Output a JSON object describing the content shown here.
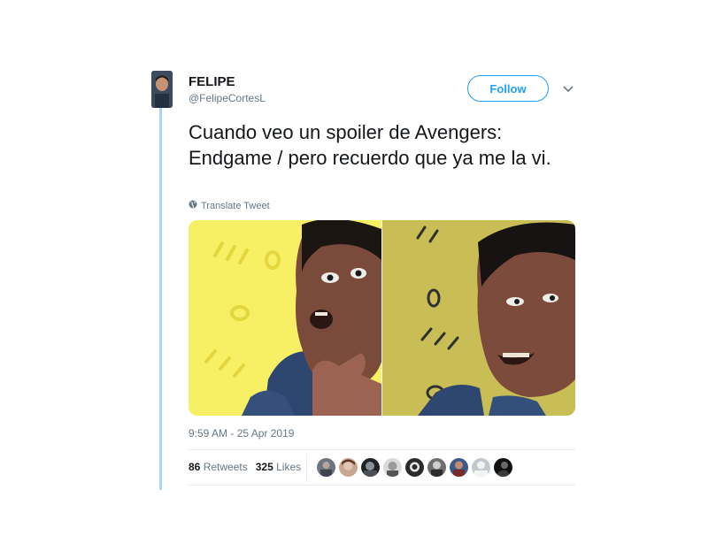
{
  "user": {
    "name": "FELIPE",
    "handle": "@FelipeCortesL"
  },
  "follow_label": "Follow",
  "tweet": {
    "text": "Cuando veo un spoiler de Avengers: Endgame / pero recuerdo que ya me la vi.",
    "translate_label": "Translate Tweet",
    "timestamp": "9:59 AM - 25 Apr 2019"
  },
  "stats": {
    "retweets_count": "86",
    "retweets_label": "Retweets",
    "likes_count": "325",
    "likes_label": "Likes"
  },
  "colors": {
    "accent": "#1da1f2",
    "thread_line": "#a8d7f5",
    "panel_left_bg": "#f7f064",
    "panel_right_bg": "#c9be55"
  },
  "likers": [
    {
      "icon": "avatar-icon"
    },
    {
      "icon": "avatar-icon"
    },
    {
      "icon": "avatar-icon"
    },
    {
      "icon": "avatar-icon"
    },
    {
      "icon": "avatar-icon"
    },
    {
      "icon": "avatar-icon"
    },
    {
      "icon": "avatar-icon"
    },
    {
      "icon": "avatar-icon"
    },
    {
      "icon": "avatar-icon"
    }
  ]
}
